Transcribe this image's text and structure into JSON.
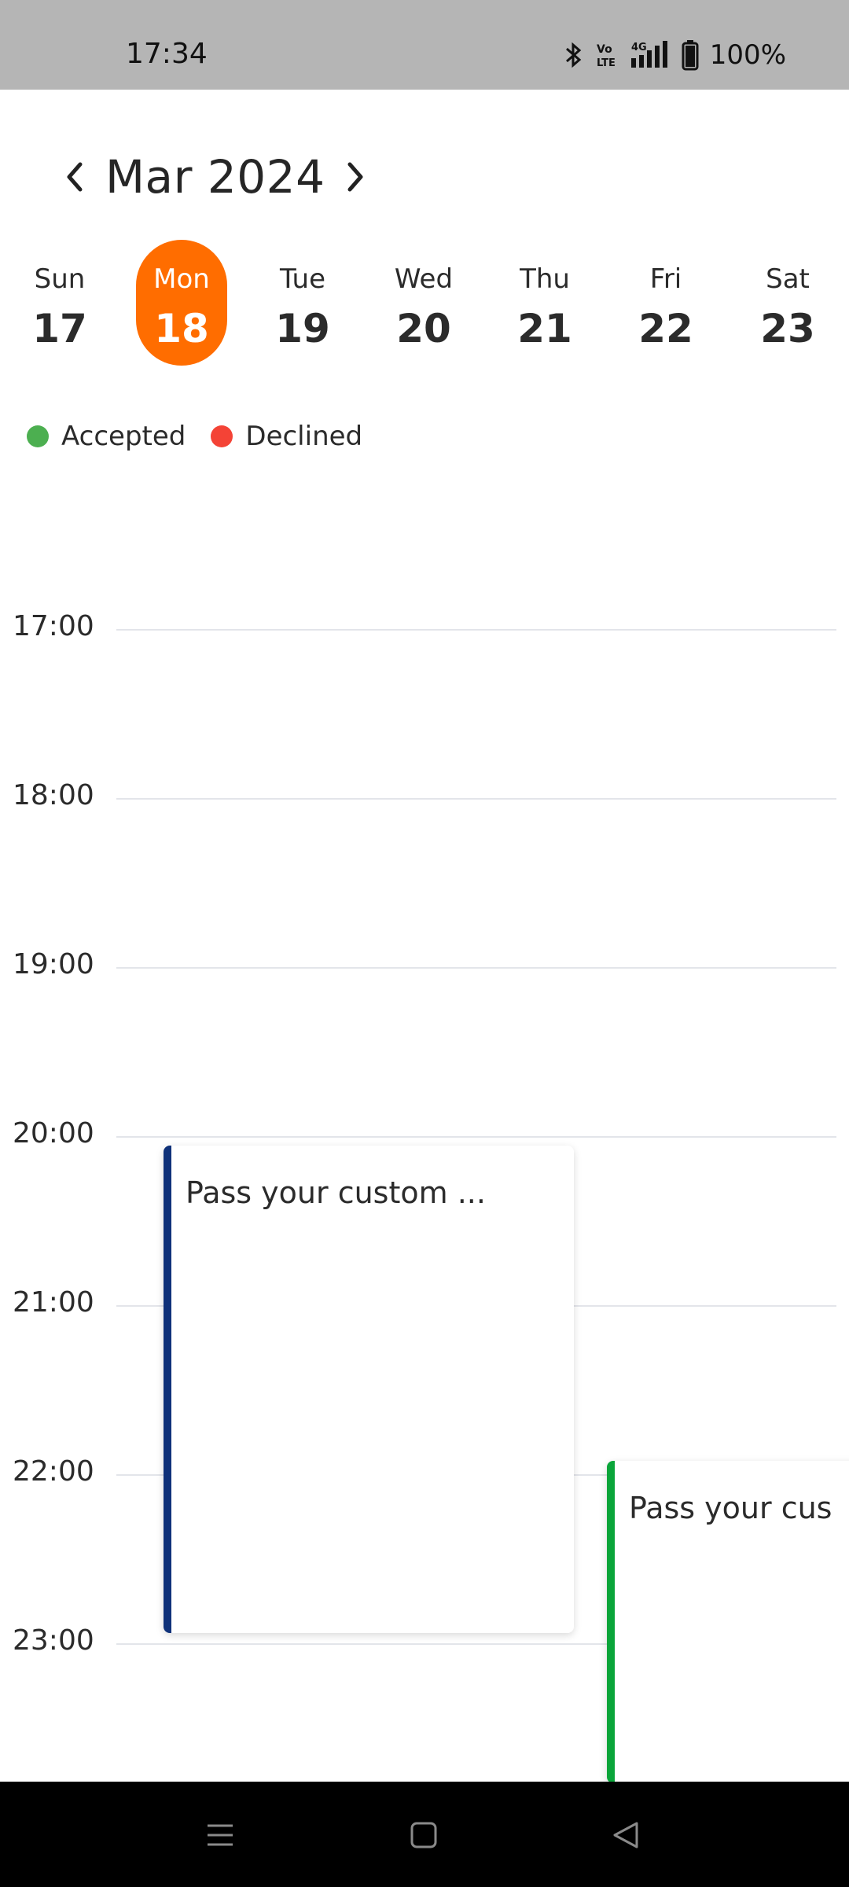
{
  "status_bar": {
    "time": "17:34",
    "battery": "100%",
    "icons": [
      "bluetooth-icon",
      "volte-icon",
      "signal-4g-icon",
      "battery-icon"
    ]
  },
  "header": {
    "month_label": "Mar 2024",
    "prev_icon": "chevron-left-icon",
    "next_icon": "chevron-right-icon"
  },
  "week": [
    {
      "name": "Sun",
      "num": "17"
    },
    {
      "name": "Mon",
      "num": "18"
    },
    {
      "name": "Tue",
      "num": "19"
    },
    {
      "name": "Wed",
      "num": "20"
    },
    {
      "name": "Thu",
      "num": "21"
    },
    {
      "name": "Fri",
      "num": "22"
    },
    {
      "name": "Sat",
      "num": "23"
    }
  ],
  "selected_day": "Mon 18",
  "legend": [
    {
      "label": "Accepted",
      "color": "#4caf50"
    },
    {
      "label": "Declined",
      "color": "#f44336"
    }
  ],
  "hours": [
    "17:00",
    "18:00",
    "19:00",
    "20:00",
    "21:00",
    "22:00",
    "23:00"
  ],
  "events": [
    {
      "title": "Pass your custom ...",
      "color": "#10327a"
    },
    {
      "title": "Pass your cus",
      "color": "#0aa53a"
    }
  ],
  "colors": {
    "accent": "#ff6d00",
    "status_bar": "#b5b5b5",
    "grid_line": "#e3e5ea"
  },
  "nav_bar": [
    "menu-icon",
    "home-icon",
    "back-icon"
  ]
}
